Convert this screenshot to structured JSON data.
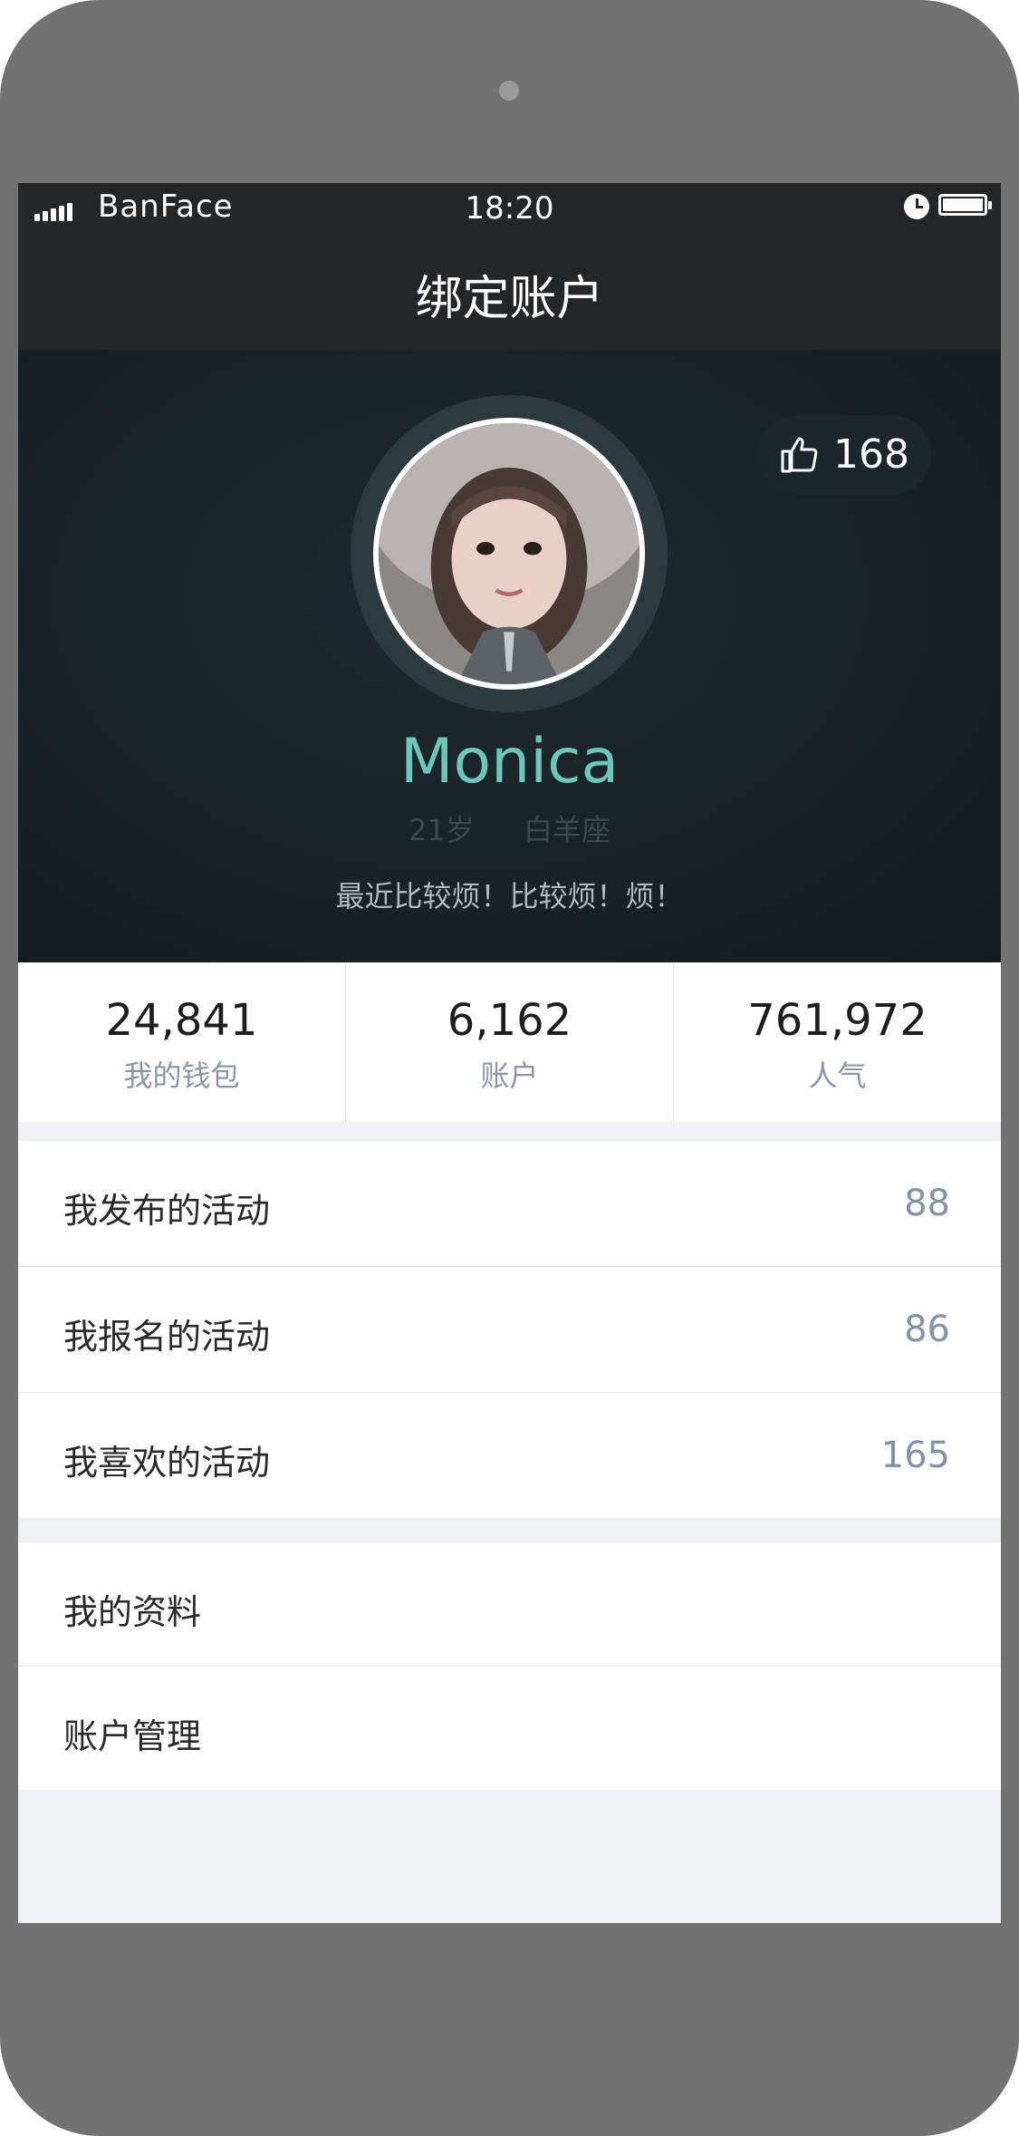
{
  "status_bar": {
    "carrier": "BanFace",
    "time": "18:20"
  },
  "header": {
    "title": "绑定账户"
  },
  "profile": {
    "likes": "168",
    "name": "Monica",
    "age": "21岁",
    "zodiac": "白羊座",
    "bio": "最近比较烦！比较烦！烦！"
  },
  "stats": [
    {
      "value": "24,841",
      "label": "我的钱包"
    },
    {
      "value": "6,162",
      "label": "账户"
    },
    {
      "value": "761,972",
      "label": "人气"
    }
  ],
  "activities": [
    {
      "label": "我发布的活动",
      "count": "88"
    },
    {
      "label": "我报名的活动",
      "count": "86"
    },
    {
      "label": "我喜欢的活动",
      "count": "165"
    }
  ],
  "settings": [
    {
      "label": "我的资料"
    },
    {
      "label": "账户管理"
    }
  ],
  "colors": {
    "accent": "#6ec5bb",
    "header_bg": "#252628",
    "hero_bg": "#1b2428"
  }
}
